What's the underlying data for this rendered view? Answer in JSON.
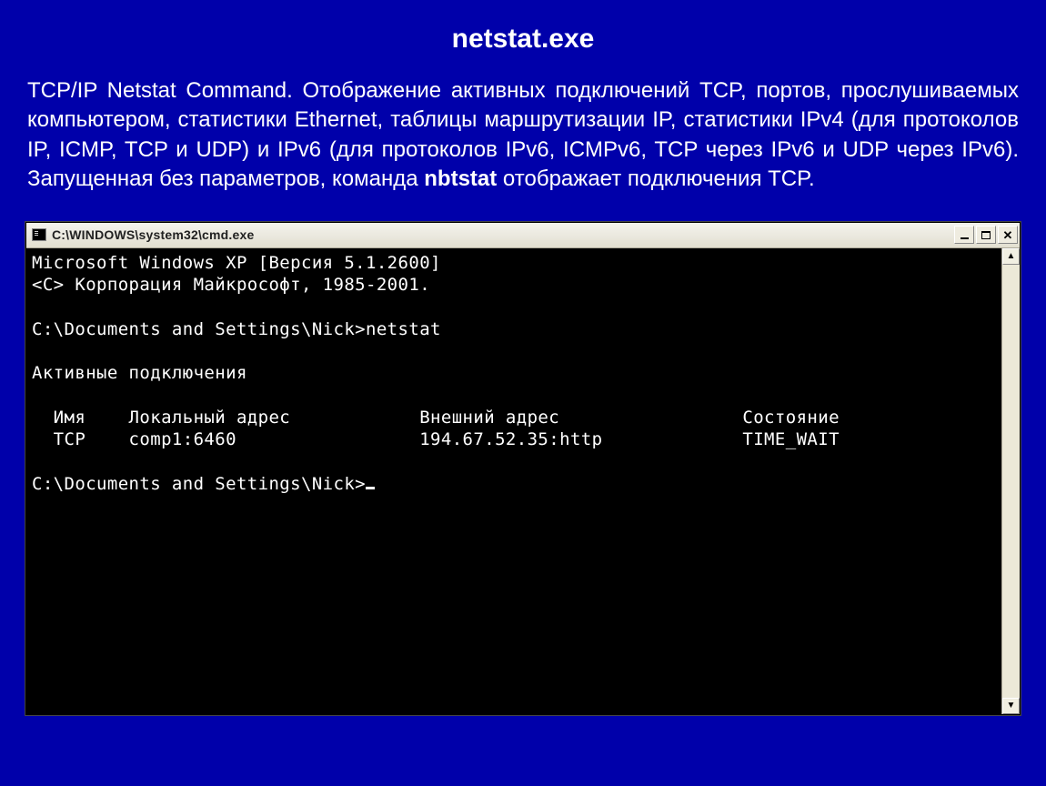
{
  "title": "netstat.exe",
  "description": {
    "part1": "TCP/IP Netstat Command. Отображение активных подключений TCP, портов, прослушиваемых компьютером, статистики Ethernet, таблицы маршрутизации IP, статистики IPv4 (для протоколов IP, ICMP, TCP и UDP) и IPv6 (для протоколов IPv6, ICMPv6, TCP через IPv6 и UDP через IPv6). Запущенная без параметров, команда ",
    "bold": "nbtstat",
    "part2": " отображает подключения TCP."
  },
  "cmd_window": {
    "icon_label": "cmd-icon",
    "caption": "C:\\WINDOWS\\system32\\cmd.exe",
    "controls": {
      "minimize": "Minimize",
      "maximize": "Maximize",
      "close": "Close"
    },
    "scrollbar": {
      "up": "▲",
      "down": "▼"
    },
    "console": {
      "line1": "Microsoft Windows XP [Версия 5.1.2600]",
      "line2": "<C> Корпорация Майкрософт, 1985-2001.",
      "blank1": "",
      "line3": "C:\\Documents and Settings\\Nick>netstat",
      "blank2": "",
      "line4": "Активные подключения",
      "blank3": "",
      "header": {
        "c1": "Имя",
        "c2": "Локальный адрес",
        "c3": "Внешний адрес",
        "c4": "Состояние"
      },
      "row": {
        "c1": "TCP",
        "c2": "comp1:6460",
        "c3": "194.67.52.35:http",
        "c4": "TIME_WAIT"
      },
      "blank4": "",
      "line5": "C:\\Documents and Settings\\Nick>"
    }
  }
}
